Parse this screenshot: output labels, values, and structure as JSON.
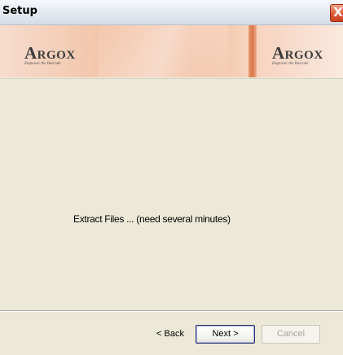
{
  "window": {
    "title": "Setup",
    "close_glyph": "X"
  },
  "banner": {
    "logo_left": {
      "cap": "A",
      "rest": "RGOX",
      "tagline": "Empower the Barcode"
    },
    "logo_right": {
      "cap": "A",
      "rest": "RGOX",
      "tagline": "Empower the Barcode"
    }
  },
  "content": {
    "status": "Extract Files ... (need several minutes)"
  },
  "buttons": {
    "back": "< Back",
    "next": "Next >",
    "cancel": "Cancel",
    "cancel_enabled": false
  },
  "colors": {
    "accent_banner": "#f0b999",
    "close_button": "#de5a36",
    "dialog_background": "#ece9d8"
  }
}
